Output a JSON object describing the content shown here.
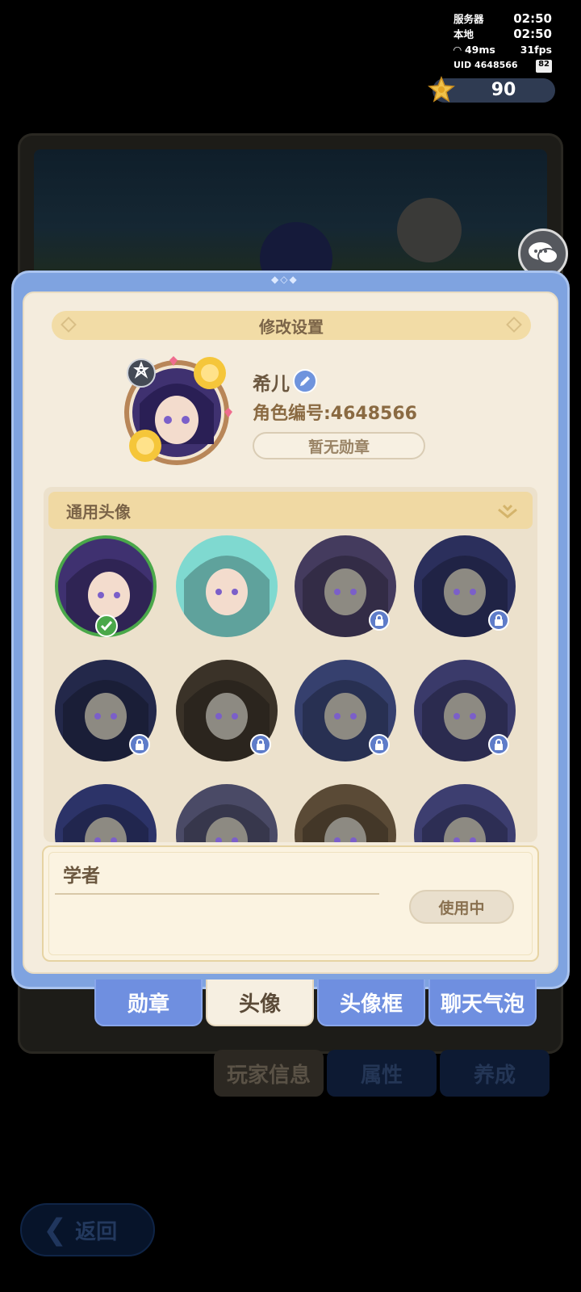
{
  "hud": {
    "server_label": "服务器",
    "server_time": "02:50",
    "local_label": "本地",
    "local_time": "02:50",
    "ping": "49ms",
    "fps": "31fps",
    "uid": "UID 4648566",
    "battery": "82"
  },
  "currency": {
    "value": "90",
    "icon": "star-coin-icon"
  },
  "background": {
    "tabs": [
      "玩家信息",
      "属性",
      "养成"
    ],
    "back_label": "返回"
  },
  "dialog": {
    "title": "修改设置",
    "profile": {
      "name": "希儿",
      "id_text": "角色编号:4648566",
      "badge_text": "暂无勋章"
    },
    "section_title": "通用头像",
    "avatars": [
      {
        "selected": true,
        "locked": false,
        "color": "#3f3170"
      },
      {
        "selected": false,
        "locked": false,
        "color": "#7fd9d0"
      },
      {
        "selected": false,
        "locked": true,
        "color": "#443b5e"
      },
      {
        "selected": false,
        "locked": true,
        "color": "#2b2f5c"
      },
      {
        "selected": false,
        "locked": true,
        "color": "#23284a"
      },
      {
        "selected": false,
        "locked": true,
        "color": "#3a3228"
      },
      {
        "selected": false,
        "locked": true,
        "color": "#36406e"
      },
      {
        "selected": false,
        "locked": true,
        "color": "#3a3a6a"
      },
      {
        "selected": false,
        "locked": true,
        "color": "#2c3368"
      },
      {
        "selected": false,
        "locked": true,
        "color": "#4a4a66"
      },
      {
        "selected": false,
        "locked": true,
        "color": "#5a4a36"
      },
      {
        "selected": false,
        "locked": true,
        "color": "#3d3e70"
      }
    ],
    "selected_name": "学者",
    "use_label": "使用中",
    "tabs": [
      "勋章",
      "头像",
      "头像框",
      "聊天气泡"
    ],
    "active_tab": "头像"
  }
}
